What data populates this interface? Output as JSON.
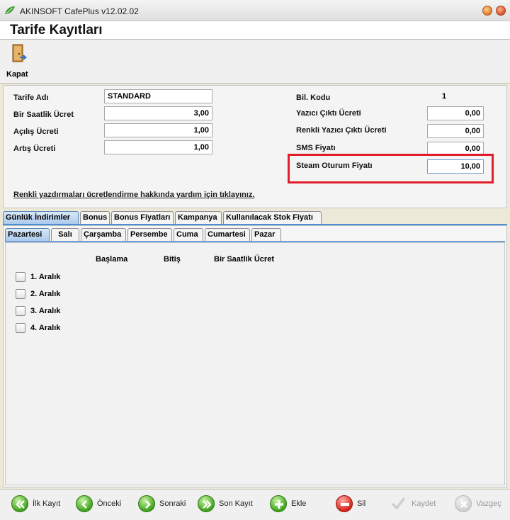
{
  "window": {
    "title": "AKINSOFT CafePlus v12.02.02"
  },
  "header": {
    "title": "Tarife Kayıtları"
  },
  "toolbar": {
    "close_label": "Kapat"
  },
  "form": {
    "tariff_name_label": "Tarife Adı",
    "tariff_name_value": "STANDARD",
    "hourly_fee_label": "Bir Saatlik Ücret",
    "hourly_fee_value": "3,00",
    "opening_fee_label": "Açılış Ücreti",
    "opening_fee_value": "1,00",
    "increment_fee_label": "Artış Ücreti",
    "increment_fee_value": "1,00",
    "bil_code_label": "Bil. Kodu",
    "bil_code_value": "1",
    "printer_fee_label": "Yazıcı Çıktı Ücreti",
    "printer_fee_value": "0,00",
    "color_printer_fee_label": "Renkli Yazıcı Çıktı Ücreti",
    "color_printer_fee_value": "0,00",
    "sms_price_label": "SMS Fiyatı",
    "sms_price_value": "0,00",
    "steam_price_label": "Steam Oturum Fiyatı",
    "steam_price_value": "10,00",
    "help_link": "Renkli yazdırmaları ücretlendirme hakkında yardım için tıklayınız."
  },
  "main_tabs": [
    {
      "label": "Günlük İndirimler"
    },
    {
      "label": "Bonus"
    },
    {
      "label": "Bonus Fiyatları"
    },
    {
      "label": "Kampanya"
    },
    {
      "label": "Kullanılacak Stok Fiyatı"
    }
  ],
  "day_tabs": [
    {
      "label": "Pazartesi"
    },
    {
      "label": "Salı"
    },
    {
      "label": "Çarşamba"
    },
    {
      "label": "Persembe"
    },
    {
      "label": "Cuma"
    },
    {
      "label": "Cumartesi"
    },
    {
      "label": "Pazar"
    }
  ],
  "intervals": {
    "headers": [
      "Başlama",
      "Bitiş",
      "Bir Saatlik Ücret"
    ],
    "rows": [
      "1. Aralık",
      "2. Aralık",
      "3. Aralık",
      "4. Aralık"
    ]
  },
  "nav": {
    "first": "İlk Kayıt",
    "prev": "Önceki",
    "next": "Sonraki",
    "last": "Son Kayıt",
    "add": "Ekle",
    "delete": "Sil",
    "save": "Kaydet",
    "cancel": "Vazgeç"
  },
  "colors": {
    "highlight": "#e01e2a",
    "active_tab": "#a9c8ec",
    "accent_line": "#4b8fd3"
  }
}
